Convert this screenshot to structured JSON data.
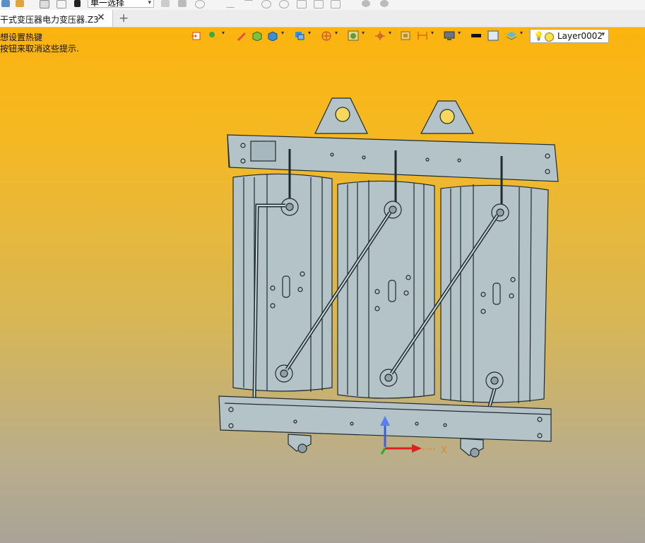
{
  "top_strip": {
    "selection_mode": "单一选择"
  },
  "tabs": {
    "active_title": "干式变压器电力变压器.Z3",
    "close_symbol": "✕",
    "new_tab_symbol": "+"
  },
  "hints": {
    "line1": "想设置热键",
    "line2": "按钮来取消这些提示."
  },
  "toolbar": {
    "layer_name": "Layer0002",
    "icons": [
      "insert-component-icon",
      "paint-icon",
      "pencil-icon",
      "box-solid-icon",
      "shaded-cube-icon",
      "display-mode-icon",
      "cross-section-icon",
      "view-render-icon",
      "origin-axis-icon",
      "frame-icon",
      "dimension-icon",
      "monitor-icon",
      "line-color-icon",
      "fill-color-icon",
      "layer-stack-icon",
      "lightbulb-icon"
    ]
  },
  "triad": {
    "x_label": "X"
  },
  "colors": {
    "viewport_top": "#fbb40f",
    "viewport_bottom": "#a9a397",
    "model_fill": "#b3c3c8",
    "model_stroke": "#1f2b2f"
  }
}
